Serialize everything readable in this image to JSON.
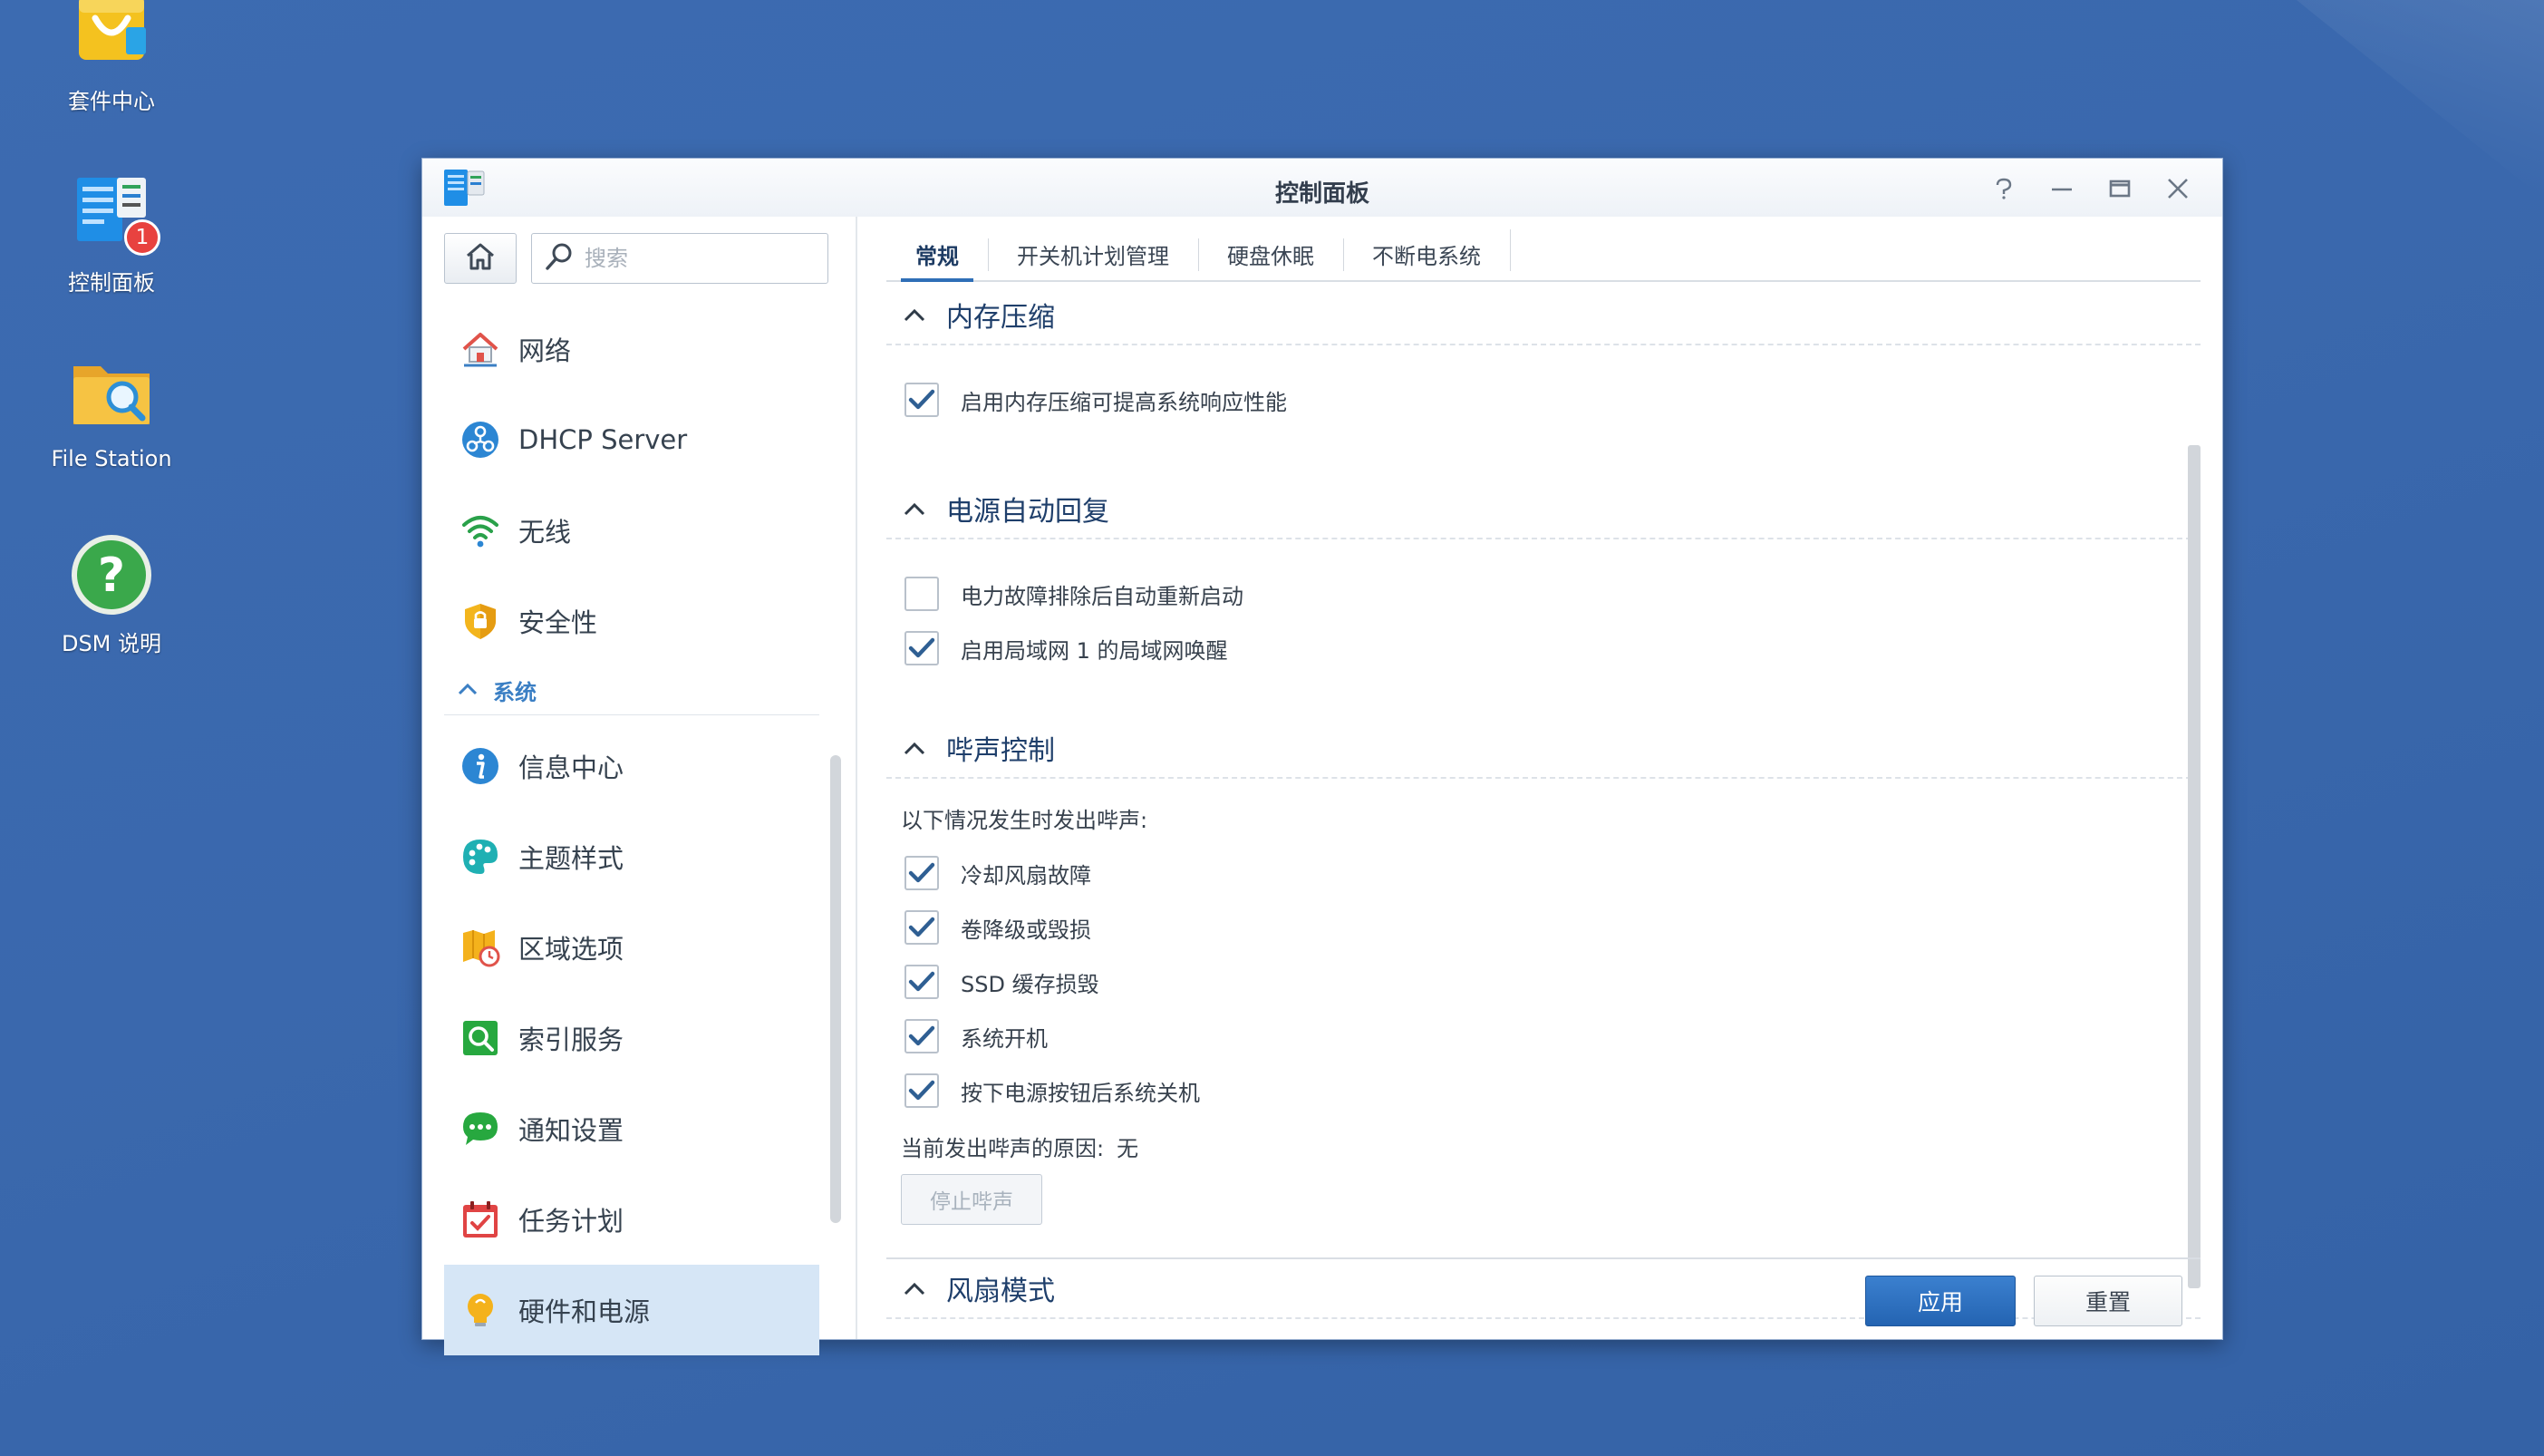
{
  "desktop": {
    "icons": [
      {
        "label": "套件中心",
        "icon": "package-center-icon"
      },
      {
        "label": "控制面板",
        "icon": "control-panel-icon",
        "badge": "1"
      },
      {
        "label": "File Station",
        "icon": "file-station-icon"
      },
      {
        "label": "DSM 说明",
        "icon": "help-icon"
      }
    ]
  },
  "window": {
    "title": "控制面板",
    "controls": [
      "help-icon",
      "minimize-icon",
      "maximize-icon",
      "close-icon"
    ]
  },
  "sidebar": {
    "search_placeholder": "搜索",
    "items_top": [
      {
        "label": "网络",
        "icon": "network-icon"
      },
      {
        "label": "DHCP Server",
        "icon": "dhcp-server-icon"
      },
      {
        "label": "无线",
        "icon": "wireless-icon"
      },
      {
        "label": "安全性",
        "icon": "security-shield-icon"
      }
    ],
    "section": "系统",
    "items_system": [
      {
        "label": "信息中心",
        "icon": "info-icon"
      },
      {
        "label": "主题样式",
        "icon": "theme-palette-icon"
      },
      {
        "label": "区域选项",
        "icon": "regional-options-icon"
      },
      {
        "label": "索引服务",
        "icon": "indexing-icon"
      },
      {
        "label": "通知设置",
        "icon": "notification-icon"
      },
      {
        "label": "任务计划",
        "icon": "task-scheduler-icon"
      },
      {
        "label": "硬件和电源",
        "icon": "hardware-power-icon",
        "active": true
      }
    ]
  },
  "tabs": [
    {
      "label": "常规",
      "active": true
    },
    {
      "label": "开关机计划管理"
    },
    {
      "label": "硬盘休眠"
    },
    {
      "label": "不断电系统"
    }
  ],
  "sections": {
    "memory": {
      "title": "内存压缩",
      "options": [
        {
          "label": "启用内存压缩可提高系统响应性能",
          "checked": true
        }
      ]
    },
    "power_recovery": {
      "title": "电源自动回复",
      "options": [
        {
          "label": "电力故障排除后自动重新启动",
          "checked": false
        },
        {
          "label": "启用局域网 1 的局域网唤醒",
          "checked": true
        }
      ]
    },
    "beep": {
      "title": "哔声控制",
      "intro": "以下情况发生时发出哔声:",
      "options": [
        {
          "label": "冷却风扇故障",
          "checked": true
        },
        {
          "label": "卷降级或毁损",
          "checked": true
        },
        {
          "label": "SSD 缓存损毁",
          "checked": true
        },
        {
          "label": "系统开机",
          "checked": true
        },
        {
          "label": "按下电源按钮后系统关机",
          "checked": true
        }
      ],
      "reason_label": "当前发出哔声的原因:",
      "reason_value": "无",
      "stop_button": "停止哔声"
    },
    "fan": {
      "title": "风扇模式"
    }
  },
  "footer": {
    "apply": "应用",
    "reset": "重置"
  },
  "colors": {
    "desktop": "#3a68ad",
    "accent": "#2f6fb7",
    "active_nav": "#d6e6f6",
    "badge": "#e8423f"
  }
}
